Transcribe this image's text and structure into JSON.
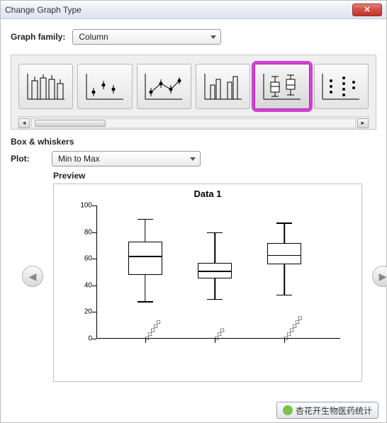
{
  "window": {
    "title": "Change Graph Type"
  },
  "graphFamily": {
    "label": "Graph family:",
    "value": "Column"
  },
  "thumbs": {
    "names": [
      "bar-thumb",
      "scatter-thumb",
      "xy-scatter-thumb",
      "grouped-bar-thumb",
      "box-whisker-thumb",
      "dot-column-thumb"
    ],
    "selectedIndex": 4
  },
  "subType": {
    "title": "Box & whiskers",
    "plotLabel": "Plot:",
    "plotValue": "Min to Max"
  },
  "preview": {
    "label": "Preview"
  },
  "bottomButton": {
    "label": "杏花开生物医药统计"
  },
  "chart_data": {
    "type": "box",
    "title": "Data 1",
    "ylabel": "",
    "ylim": [
      0,
      100
    ],
    "yticks": [
      0,
      20,
      40,
      60,
      80,
      100
    ],
    "categories": [
      "◇◇◇◇◇",
      "◇◇◇",
      "◇◇◇◇◇◇"
    ],
    "series": [
      {
        "min": 28,
        "q1": 48,
        "median": 62,
        "q3": 73,
        "max": 90
      },
      {
        "min": 30,
        "q1": 45,
        "median": 51,
        "q3": 57,
        "max": 80
      },
      {
        "min": 33,
        "q1": 56,
        "median": 63,
        "q3": 72,
        "max": 87
      }
    ]
  }
}
